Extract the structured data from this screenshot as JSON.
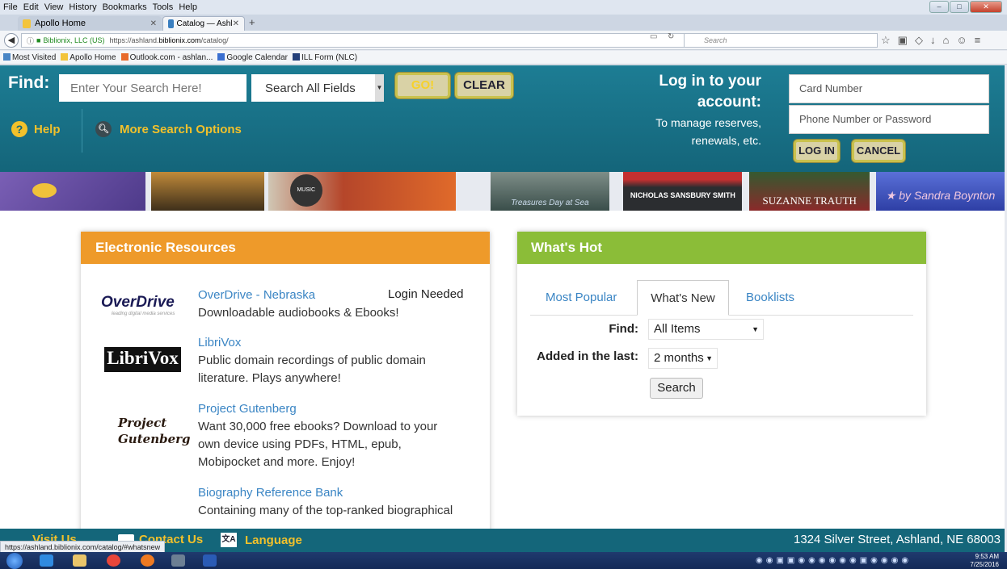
{
  "browser": {
    "menu": [
      "File",
      "Edit",
      "View",
      "History",
      "Bookmarks",
      "Tools",
      "Help"
    ],
    "tabs": [
      {
        "label": "Apollo Home"
      },
      {
        "label": "Catalog — Ashland Public ..."
      }
    ],
    "url_site": "Biblionix, LLC (US)",
    "url_prefix": "https://ashland.",
    "url_host": "biblionix.com",
    "url_path": "/catalog/",
    "search_placeholder": "Search",
    "bookmarks": [
      "Most Visited",
      "Apollo Home",
      "Outlook.com - ashlan...",
      "Google Calendar",
      "ILL Form (NLC)"
    ],
    "status_url": "https://ashland.biblionix.com/catalog/#whatsnew"
  },
  "header": {
    "find_label": "Find:",
    "search_placeholder": "Enter Your Search Here!",
    "field_select": "Search All Fields",
    "go_label": "GO!",
    "clear_label": "CLEAR",
    "help_label": "Help",
    "more_options_label": "More Search Options",
    "login_title_1": "Log in to your",
    "login_title_2": "account:",
    "login_sub_1": "To manage reserves,",
    "login_sub_2": "renewals, etc.",
    "card_placeholder": "Card Number",
    "password_placeholder": "Phone Number or Password",
    "login_label": "LOG IN",
    "cancel_label": "CANCEL"
  },
  "banner": {
    "covers": [
      {
        "caption": "",
        "color": "#6b4fa0"
      },
      {
        "caption": "",
        "color": "#8a6a2a"
      },
      {
        "caption": "",
        "color": "#b5462a"
      },
      {
        "caption": "Treasures Day at Sea",
        "color": "#5a6e6a"
      },
      {
        "caption": "NICHOLAS SANSBURY SMITH",
        "color": "#2e3033"
      },
      {
        "caption": "SUZANNE TRAUTH",
        "color": "#7a2a2a"
      },
      {
        "caption": "by Sandra Boynton",
        "color": "#3a4fb5"
      }
    ]
  },
  "electronic_resources": {
    "title": "Electronic Resources",
    "login_needed": "Login Needed",
    "items": [
      {
        "logo": "OverDrive",
        "logo_sub": "leading digital media services",
        "title": "OverDrive - Nebraska",
        "desc": "Downloadable audiobooks & Ebooks!"
      },
      {
        "logo": "LibriVox",
        "title": "LibriVox",
        "desc_1": "Public domain recordings of public domain",
        "desc_2": "literature. Plays anywhere!"
      },
      {
        "logo_1": "Project",
        "logo_2": "Gutenberg",
        "title": "Project Gutenberg",
        "desc_1": "Want 30,000 free ebooks? Download to your",
        "desc_2": "own device using PDFs, HTML, epub,",
        "desc_3": "Mobipocket and more. Enjoy!"
      },
      {
        "title": "Biography Reference Bank",
        "desc_1": "Containing many of the top-ranked biographical"
      }
    ]
  },
  "whats_hot": {
    "title": "What's Hot",
    "tabs": [
      "Most Popular",
      "What's New",
      "Booklists"
    ],
    "find_label": "Find:",
    "find_value": "All Items",
    "added_label": "Added in the last:",
    "added_value": "2 months",
    "search_label": "Search"
  },
  "footer": {
    "visit_us": "Visit Us",
    "contact_us": "Contact Us",
    "language": "Language",
    "address": "1324 Silver Street, Ashland, NE 68003"
  },
  "taskbar": {
    "time": "9:53 AM",
    "date": "7/25/2016"
  }
}
